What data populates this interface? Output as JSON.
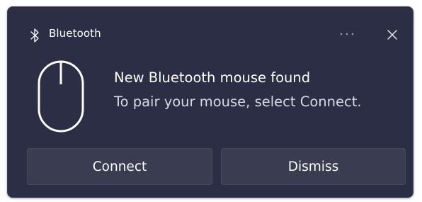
{
  "notification": {
    "app_name": "Bluetooth",
    "app_icon": "bluetooth-icon",
    "title": "New Bluetooth mouse found",
    "body": "To pair your mouse, select Connect.",
    "image_icon": "mouse-icon",
    "more_label": "···",
    "close_icon": "close-icon",
    "actions": {
      "connect_label": "Connect",
      "dismiss_label": "Dismiss"
    }
  },
  "colors": {
    "background": "#2b2e44",
    "button_background": "#3a3d52",
    "text_primary": "#ffffff",
    "text_secondary": "#d9dae2"
  }
}
